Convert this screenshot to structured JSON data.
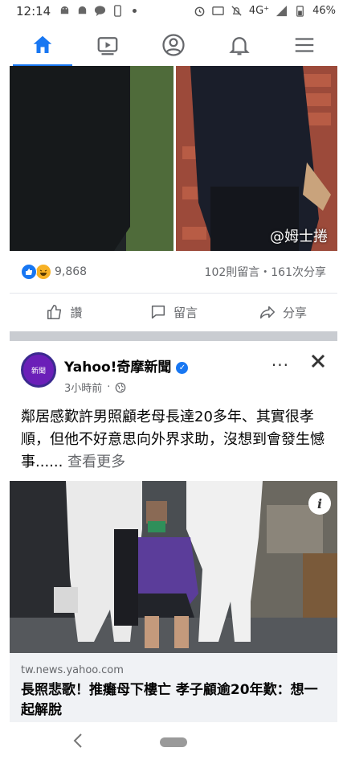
{
  "status_bar": {
    "time": "12:14",
    "network": "4G⁺",
    "battery": "46%"
  },
  "post1": {
    "watermark": "@姆士捲",
    "reaction_count": "9,868",
    "comments_shares": "102則留言・161次分享",
    "actions": {
      "like": "讚",
      "comment": "留言",
      "share": "分享"
    }
  },
  "post2": {
    "page_name": "Yahoo!奇摩新聞",
    "avatar_text": "新聞",
    "time": "3小時前",
    "more": "···",
    "text": "鄰居感歎許男照顧老母長達20多年、其實很孝順，但他不好意思向外界求助，沒想到會發生憾事......",
    "see_more": "查看更多",
    "info_badge": "i",
    "link": {
      "domain": "tw.news.yahoo.com",
      "title": "長照悲歌！推癱母下樓亡 孝子顧逾20年歎：想一起解脫"
    }
  },
  "colors": {
    "accent": "#1877f2",
    "separator": "#c9ccd1",
    "muted": "#65676b"
  }
}
